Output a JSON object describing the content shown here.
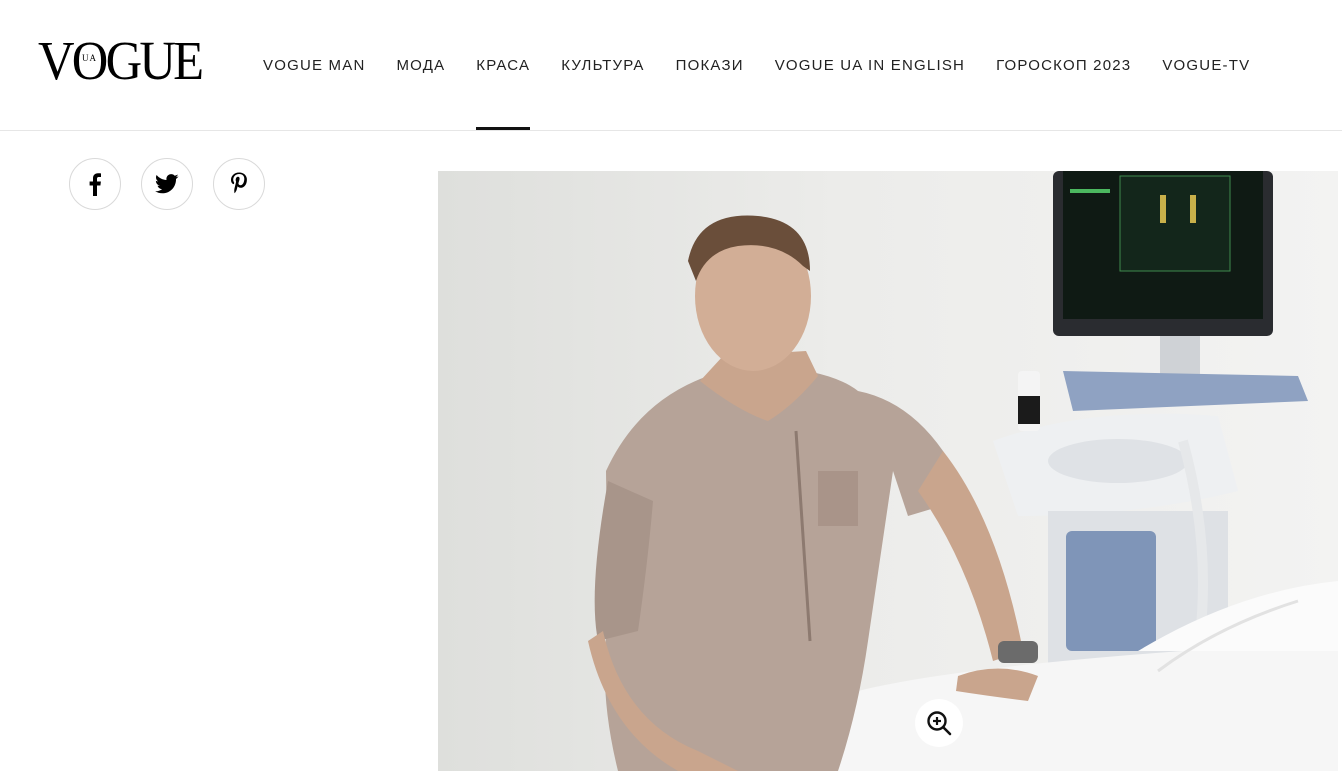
{
  "header": {
    "logo": {
      "main": "VOGUE",
      "edition": "UA"
    },
    "nav": [
      {
        "label": "VOGUE MAN",
        "active": false
      },
      {
        "label": "МОДА",
        "active": false
      },
      {
        "label": "КРАСА",
        "active": true
      },
      {
        "label": "КУЛЬТУРА",
        "active": false
      },
      {
        "label": "ПОКАЗИ",
        "active": false
      },
      {
        "label": "VOGUE UA IN ENGLISH",
        "active": false
      },
      {
        "label": "ГОРОСКОП 2023",
        "active": false
      },
      {
        "label": "VOGUE-TV",
        "active": false
      }
    ]
  },
  "share": [
    {
      "network": "facebook",
      "icon": "facebook-icon"
    },
    {
      "network": "twitter",
      "icon": "twitter-icon"
    },
    {
      "network": "pinterest",
      "icon": "pinterest-icon"
    }
  ],
  "article": {
    "image": {
      "icon": "zoom-in-icon",
      "zoomable": true
    }
  },
  "colors": {
    "text": "#111111",
    "border": "#d9d9d9",
    "active_underline": "#111111"
  }
}
